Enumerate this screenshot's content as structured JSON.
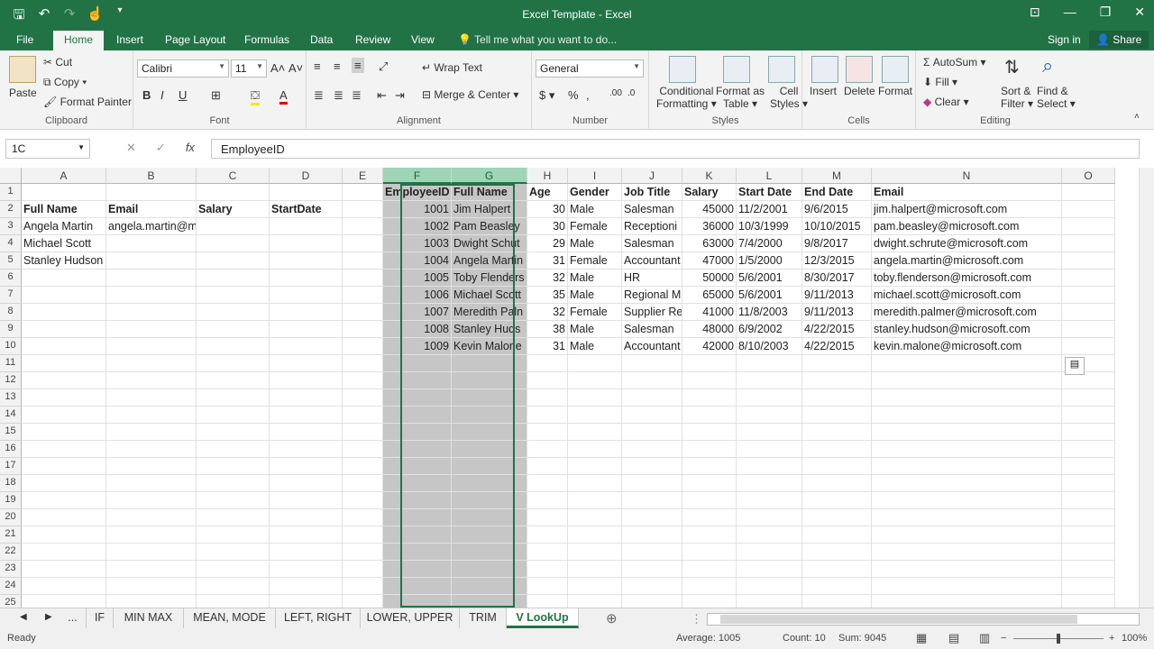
{
  "window": {
    "title": "Excel Template - Excel"
  },
  "ribbon_tabs": [
    "File",
    "Home",
    "Insert",
    "Page Layout",
    "Formulas",
    "Data",
    "Review",
    "View"
  ],
  "tellme": "Tell me what you want to do...",
  "signin": "Sign in",
  "share": "Share",
  "clipboard": {
    "paste": "Paste",
    "cut": "Cut",
    "copy": "Copy",
    "format_painter": "Format Painter",
    "label": "Clipboard"
  },
  "font": {
    "name": "Calibri",
    "size": "11",
    "label": "Font"
  },
  "alignment": {
    "wrap": "Wrap Text",
    "merge": "Merge & Center",
    "label": "Alignment"
  },
  "number": {
    "format": "General",
    "label": "Number"
  },
  "styles": {
    "cond1": "Conditional",
    "cond2": "Formatting",
    "fmt1": "Format as",
    "fmt2": "Table",
    "cell1": "Cell",
    "cell2": "Styles",
    "label": "Styles"
  },
  "cells": {
    "insert": "Insert",
    "delete": "Delete",
    "format": "Format",
    "label": "Cells"
  },
  "editing": {
    "autosum": "AutoSum",
    "fill": "Fill",
    "clear": "Clear",
    "sort1": "Sort &",
    "sort2": "Filter",
    "find1": "Find &",
    "find2": "Select",
    "label": "Editing"
  },
  "formula_bar": {
    "name_box": "1C",
    "formula": "EmployeeID"
  },
  "columns": [
    "A",
    "B",
    "C",
    "D",
    "E",
    "F",
    "G",
    "H",
    "I",
    "J",
    "K",
    "L",
    "M",
    "N",
    "O"
  ],
  "rows": [
    "1",
    "2",
    "3",
    "4",
    "5",
    "6",
    "7",
    "8",
    "9",
    "10",
    "11",
    "12",
    "13",
    "14",
    "15",
    "16",
    "17",
    "18",
    "19",
    "20",
    "21",
    "22",
    "23",
    "24",
    "25"
  ],
  "left_table": {
    "headers": [
      "Full Name",
      "Email",
      "Salary",
      "StartDate"
    ],
    "rows": [
      [
        "Angela Martin",
        "angela.martin@microsoft.com",
        "",
        ""
      ],
      [
        "Michael Scott",
        "",
        "",
        ""
      ],
      [
        "Stanley Hudson",
        "",
        "",
        ""
      ]
    ]
  },
  "right_table": {
    "headers": [
      "EmployeeID",
      "Full Name",
      "Age",
      "Gender",
      "Job Title",
      "Salary",
      "Start Date",
      "End Date",
      "Email"
    ],
    "rows": [
      [
        "1001",
        "Jim Halpert",
        "30",
        "Male",
        "Salesman",
        "45000",
        "11/2/2001",
        "9/6/2015",
        "jim.halpert@microsoft.com"
      ],
      [
        "1002",
        "Pam Beasley",
        "30",
        "Female",
        "Receptioni",
        "36000",
        "10/3/1999",
        "10/10/2015",
        "pam.beasley@microsoft.com"
      ],
      [
        "1003",
        "Dwight Schut",
        "29",
        "Male",
        "Salesman",
        "63000",
        "7/4/2000",
        "9/8/2017",
        "dwight.schrute@microsoft.com"
      ],
      [
        "1004",
        "Angela Martin",
        "31",
        "Female",
        "Accountant",
        "47000",
        "1/5/2000",
        "12/3/2015",
        "angela.martin@microsoft.com"
      ],
      [
        "1005",
        "Toby Flenders",
        "32",
        "Male",
        "HR",
        "50000",
        "5/6/2001",
        "8/30/2017",
        "toby.flenderson@microsoft.com"
      ],
      [
        "1006",
        "Michael Scott",
        "35",
        "Male",
        "Regional M",
        "65000",
        "5/6/2001",
        "9/11/2013",
        "michael.scott@microsoft.com"
      ],
      [
        "1007",
        "Meredith Paln",
        "32",
        "Female",
        "Supplier Re",
        "41000",
        "11/8/2003",
        "9/11/2013",
        "meredith.palmer@microsoft.com"
      ],
      [
        "1008",
        "Stanley Huds",
        "38",
        "Male",
        "Salesman",
        "48000",
        "6/9/2002",
        "4/22/2015",
        "stanley.hudson@microsoft.com"
      ],
      [
        "1009",
        "Kevin Malone",
        "31",
        "Male",
        "Accountant",
        "42000",
        "8/10/2003",
        "4/22/2015",
        "kevin.malone@microsoft.com"
      ]
    ]
  },
  "sheet_tabs": [
    "...",
    "IF",
    "MIN MAX",
    "MEAN, MODE",
    "LEFT, RIGHT",
    "LOWER, UPPER",
    "TRIM",
    "V LookUp"
  ],
  "status": {
    "ready": "Ready",
    "average": "Average: 1005",
    "count": "Count: 10",
    "sum": "Sum: 9045",
    "zoom": "100%"
  },
  "colors": {
    "accent": "#217346",
    "selection_fill": "#c6c6c6"
  }
}
